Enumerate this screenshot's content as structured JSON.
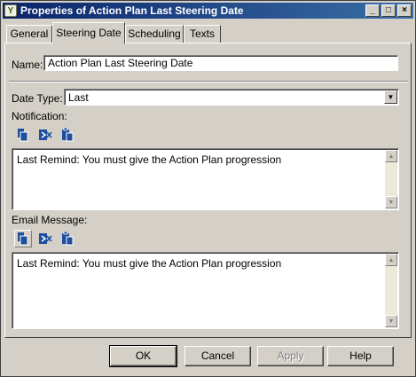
{
  "window": {
    "title": "Properties of Action Plan Last Steering Date",
    "app_icon_glyph": "Y",
    "controls": {
      "minimize": "_",
      "maximize": "□",
      "close": "×"
    }
  },
  "tabs": [
    {
      "label": "General",
      "active": false
    },
    {
      "label": "Steering Date",
      "active": true
    },
    {
      "label": "Scheduling",
      "active": false
    },
    {
      "label": "Texts",
      "active": false
    }
  ],
  "form": {
    "name_label": "Name:",
    "name_value": "Action Plan Last Steering Date",
    "date_type_label": "Date Type:",
    "date_type_value": "Last",
    "notification_label": "Notification:",
    "notification_text": "Last Remind: You must give the Action Plan progression",
    "email_label": "Email Message:",
    "email_text": "Last Remind: You must give the Action Plan progression"
  },
  "toolbar_icons": [
    "insert-field-icon",
    "insert-formula-icon",
    "paste-icon"
  ],
  "buttons": {
    "ok": "OK",
    "cancel": "Cancel",
    "apply": "Apply",
    "help": "Help"
  },
  "colors": {
    "titlebar_start": "#0a246a",
    "titlebar_end": "#3a6ea5",
    "dialog_bg": "#d4d0c8",
    "icon_blue": "#1f4e9c"
  }
}
